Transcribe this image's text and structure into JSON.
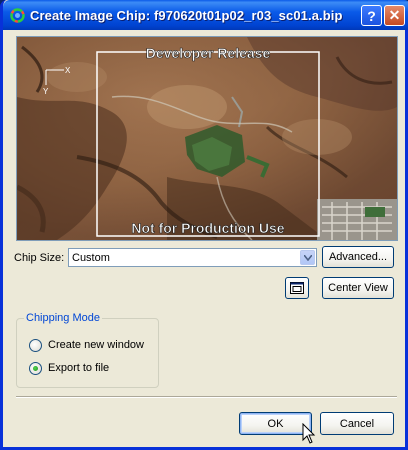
{
  "window": {
    "title": "Create Image Chip: f970620t01p02_r03_sc01.a.bip",
    "help_label": "?",
    "close_label": "✕"
  },
  "preview": {
    "watermark_top": "Developer Release",
    "watermark_bottom": "Not for Production Use",
    "axis_x_label": "X",
    "axis_y_label": "Y"
  },
  "chip_size": {
    "label": "Chip Size:",
    "value": "Custom"
  },
  "buttons": {
    "advanced": "Advanced...",
    "center_view": "Center View",
    "ok": "OK",
    "cancel": "Cancel"
  },
  "chipping_mode": {
    "title": "Chipping Mode",
    "options": [
      {
        "label": "Create new window",
        "selected": false
      },
      {
        "label": "Export to file",
        "selected": true
      }
    ]
  },
  "icons": {
    "app": "image-chip-icon",
    "zoom_extent": "frame-view-icon",
    "dropdown": "chevron-down-icon",
    "pointer": "mouse-cursor-icon"
  },
  "colors": {
    "titlebar": "#0a5ae8",
    "dialog_bg": "#ece9d8",
    "group_title": "#0046d5",
    "selection_frame": "#ffffff"
  }
}
